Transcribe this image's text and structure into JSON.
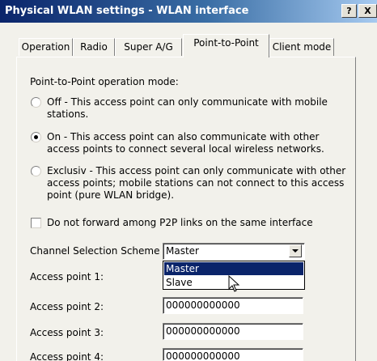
{
  "window": {
    "title": "Physical WLAN settings - WLAN interface",
    "help_label": "?",
    "close_label": "X"
  },
  "tabs": [
    {
      "label": "Operation",
      "active": false
    },
    {
      "label": "Radio",
      "active": false
    },
    {
      "label": "Super A/G",
      "active": false
    },
    {
      "label": "Point-to-Point",
      "active": true
    },
    {
      "label": "Client mode",
      "active": false
    }
  ],
  "p2p": {
    "mode_label": "Point-to-Point operation mode:",
    "options": [
      {
        "label": "Off - This access point can only communicate with mobile stations.",
        "checked": false
      },
      {
        "label": "On - This access point can also communicate with other access points to connect several local wireless networks.",
        "checked": true
      },
      {
        "label": "Exclusiv - This access point can only communicate with other access points; mobile stations can not connect to this access point (pure WLAN bridge).",
        "checked": false
      }
    ],
    "no_forward_label": "Do not forward among P2P links on the same interface",
    "no_forward_checked": false,
    "channel_scheme_label": "Channel Selection Scheme",
    "channel_scheme_value": "Master",
    "channel_scheme_options": [
      "Master",
      "Slave"
    ],
    "access_points": [
      {
        "label": "Access point 1:",
        "value": ""
      },
      {
        "label": "Access point 2:",
        "value": "000000000000"
      },
      {
        "label": "Access point 3:",
        "value": "000000000000"
      },
      {
        "label": "Access point 4:",
        "value": "000000000000"
      }
    ]
  },
  "icons": {
    "radio": "radio-button",
    "checkbox": "checkbox",
    "dropdown": "chevron-down-icon",
    "cursor": "mouse-cursor-icon"
  },
  "colors": {
    "titlebar_start": "#0a246a",
    "titlebar_end": "#a6caf0",
    "selection": "#0a246a",
    "dialog_background": "#f2f1eb"
  }
}
